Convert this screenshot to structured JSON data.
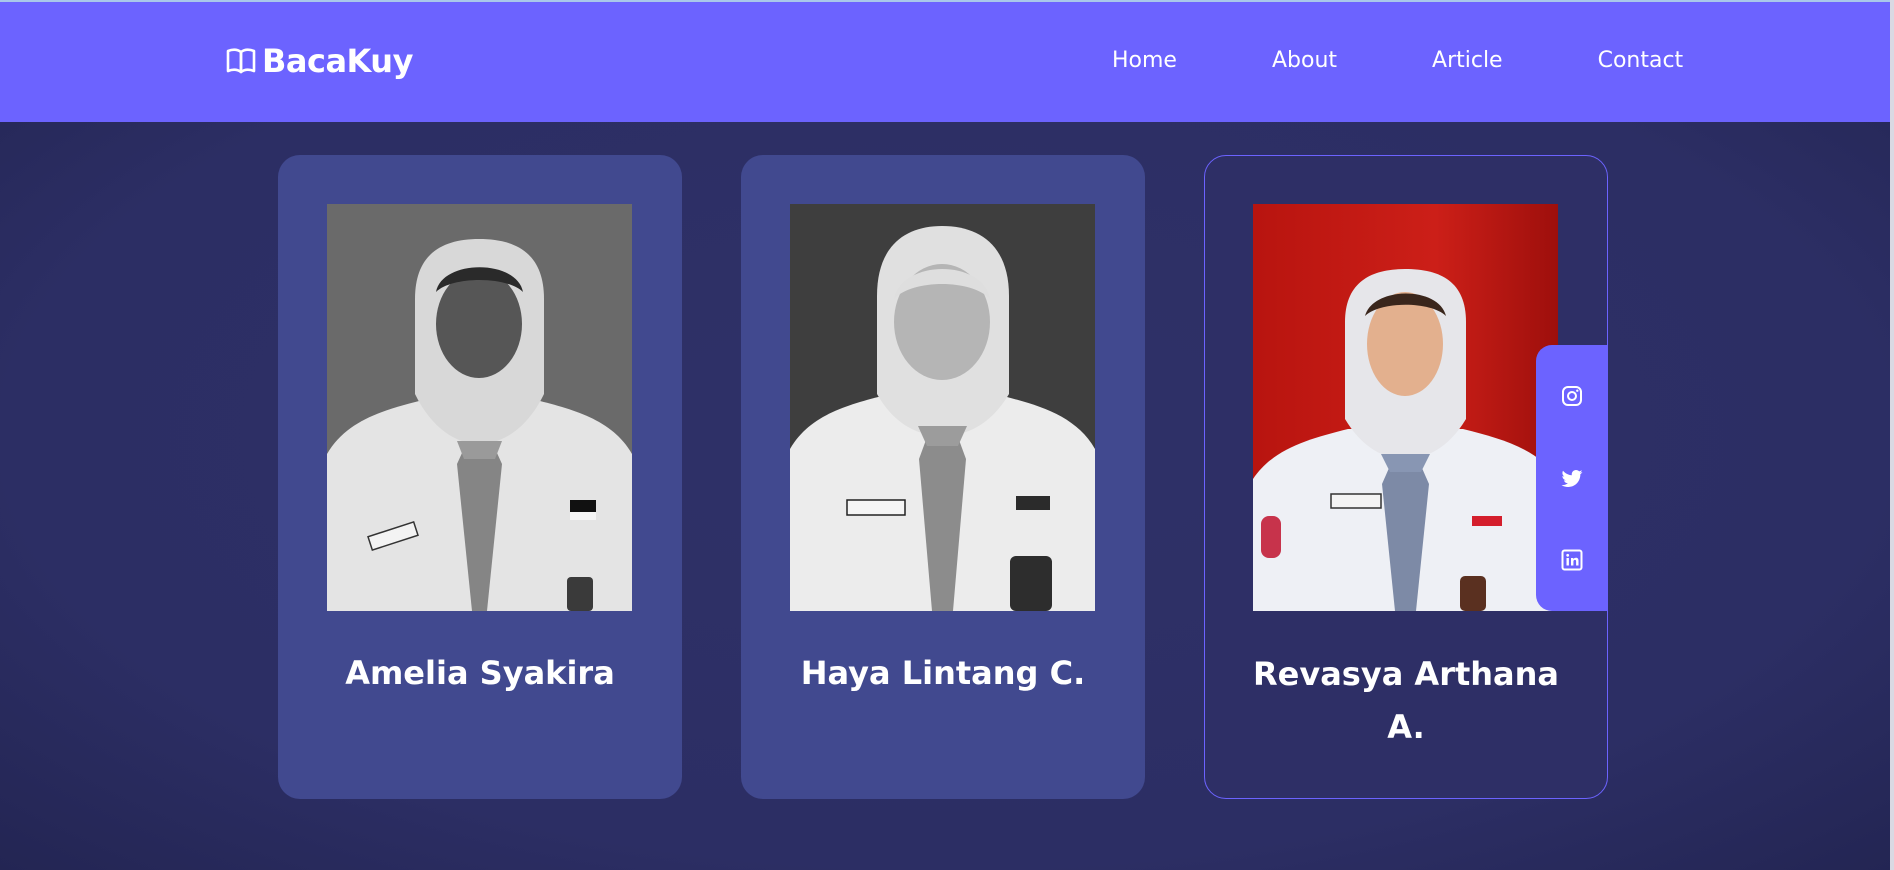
{
  "brand": {
    "name": "BacaKuy",
    "icon": "open-book-icon"
  },
  "nav": {
    "items": [
      {
        "label": "Home"
      },
      {
        "label": "About"
      },
      {
        "label": "Article"
      },
      {
        "label": "Contact"
      }
    ]
  },
  "team": {
    "members": [
      {
        "name": "Amelia Syakira",
        "photo_style": "grayscale"
      },
      {
        "name": "Haya Lintang C.",
        "photo_style": "grayscale"
      },
      {
        "name": "Revasya Arthana A.",
        "photo_style": "color",
        "state": "hovered"
      }
    ],
    "social_icons": [
      "instagram-icon",
      "twitter-icon",
      "linkedin-icon"
    ]
  },
  "colors": {
    "accent": "#6c63ff",
    "background": "#2c2d63",
    "card": "#41498f",
    "card_active": "#2e2f66"
  }
}
